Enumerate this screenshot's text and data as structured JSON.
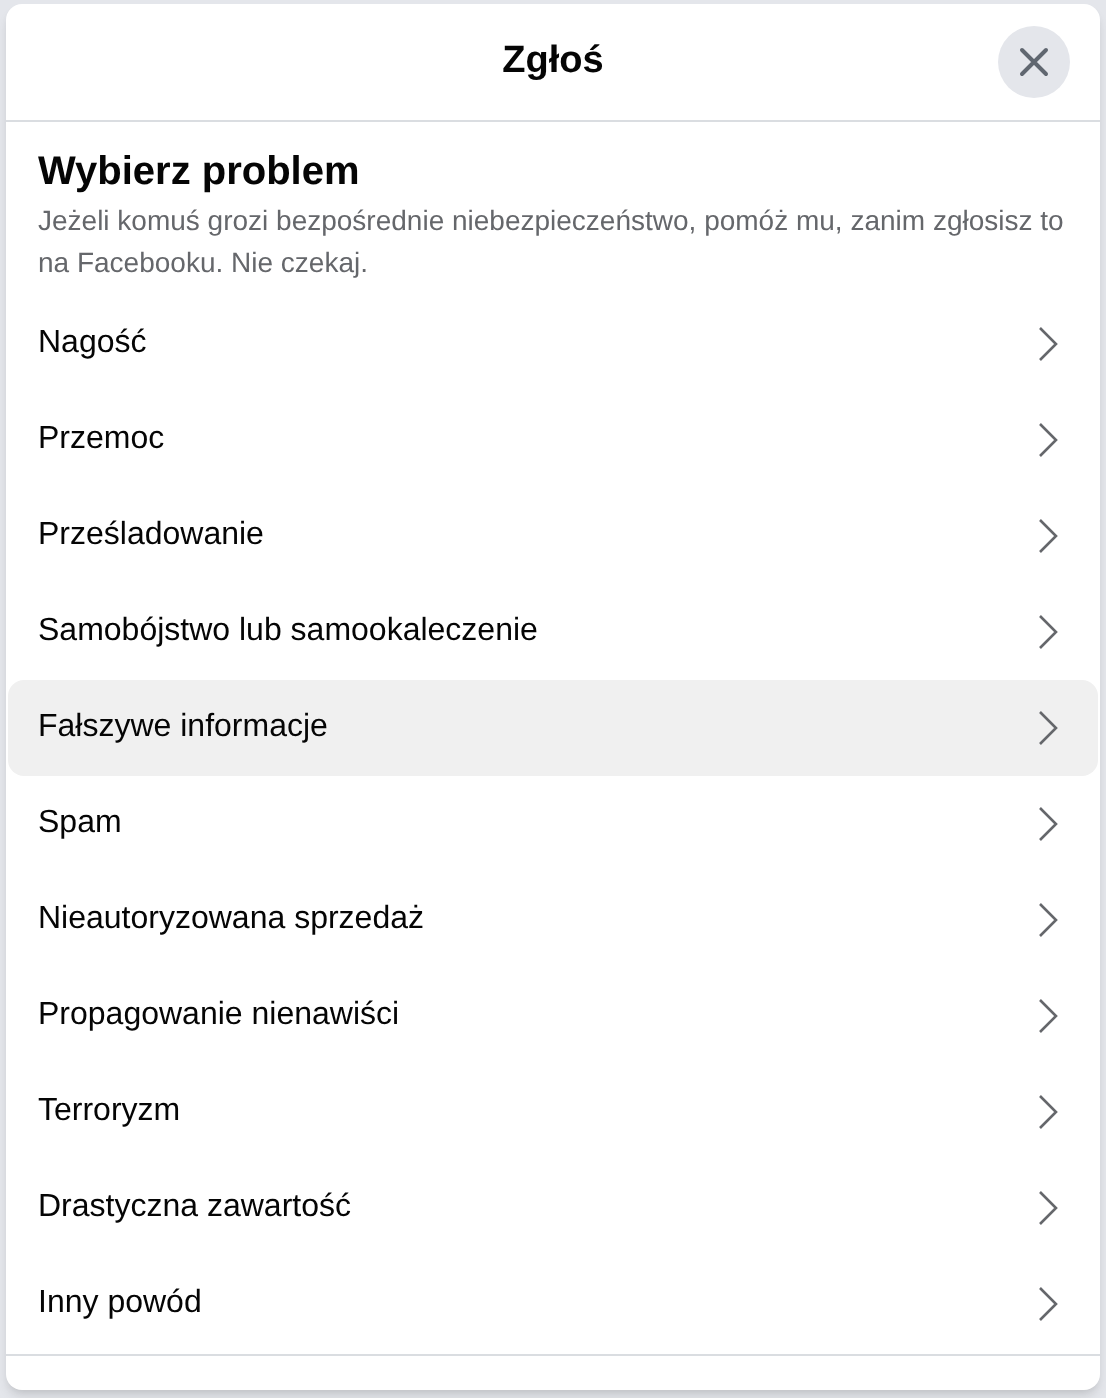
{
  "dialog": {
    "title": "Zgłoś"
  },
  "section": {
    "heading": "Wybierz problem",
    "description": "Jeżeli komuś grozi bezpośrednie niebezpieczeństwo, pomóż mu, zanim zgłosisz to na Facebooku. Nie czekaj."
  },
  "options": [
    {
      "label": "Nagość",
      "highlighted": false
    },
    {
      "label": "Przemoc",
      "highlighted": false
    },
    {
      "label": "Prześladowanie",
      "highlighted": false
    },
    {
      "label": "Samobójstwo lub samookaleczenie",
      "highlighted": false
    },
    {
      "label": "Fałszywe informacje",
      "highlighted": true
    },
    {
      "label": "Spam",
      "highlighted": false
    },
    {
      "label": "Nieautoryzowana sprzedaż",
      "highlighted": false
    },
    {
      "label": "Propagowanie nienawiści",
      "highlighted": false
    },
    {
      "label": "Terroryzm",
      "highlighted": false
    },
    {
      "label": "Drastyczna zawartość",
      "highlighted": false
    },
    {
      "label": "Inny powód",
      "highlighted": false
    }
  ]
}
